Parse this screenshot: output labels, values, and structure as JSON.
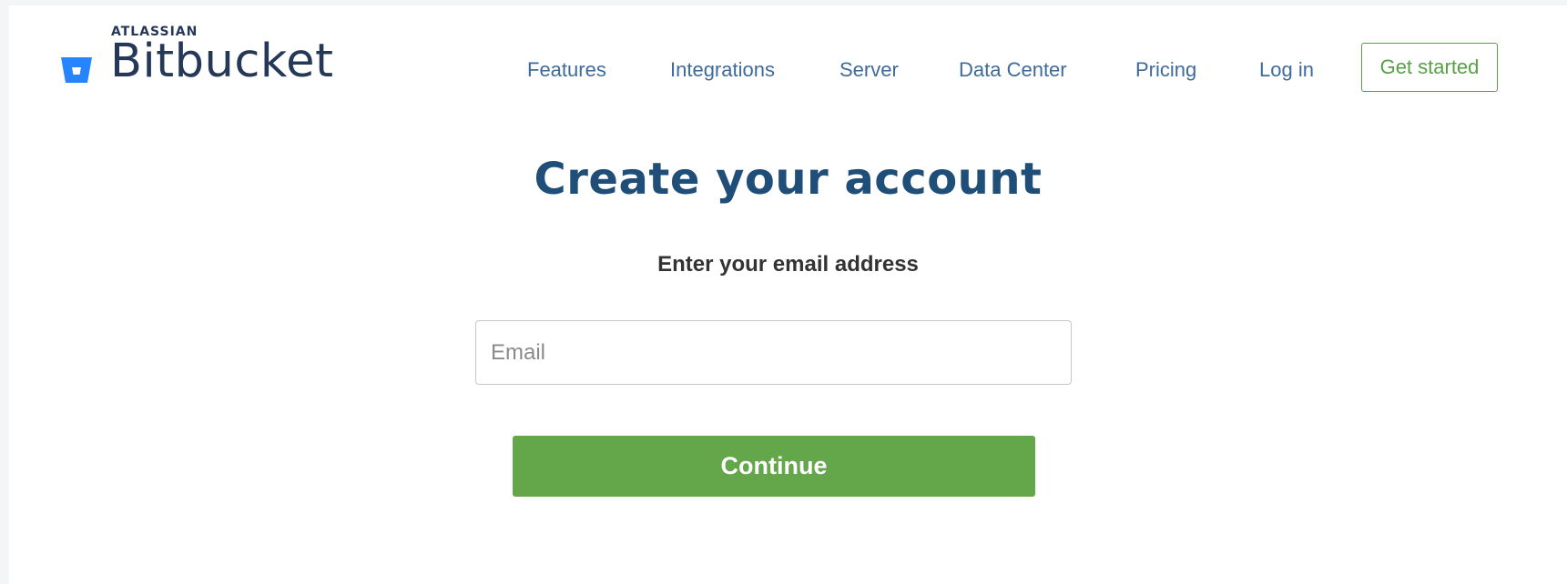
{
  "header": {
    "brand_company": "ATLASSIAN",
    "brand_product": "Bitbucket",
    "logo_icon": "bitbucket-bucket-icon",
    "nav": {
      "features": "Features",
      "integrations": "Integrations",
      "server": "Server",
      "data_center": "Data Center",
      "pricing": "Pricing",
      "login": "Log in"
    },
    "cta_label": "Get started"
  },
  "main": {
    "title": "Create your account",
    "prompt": "Enter your email address",
    "email": {
      "value": "",
      "placeholder": "Email"
    },
    "continue_label": "Continue"
  },
  "colors": {
    "brand_blue": "#2684ff",
    "heading_blue": "#1f4e79",
    "nav_text": "#3e6b9a",
    "accent_green": "#64a64a"
  }
}
